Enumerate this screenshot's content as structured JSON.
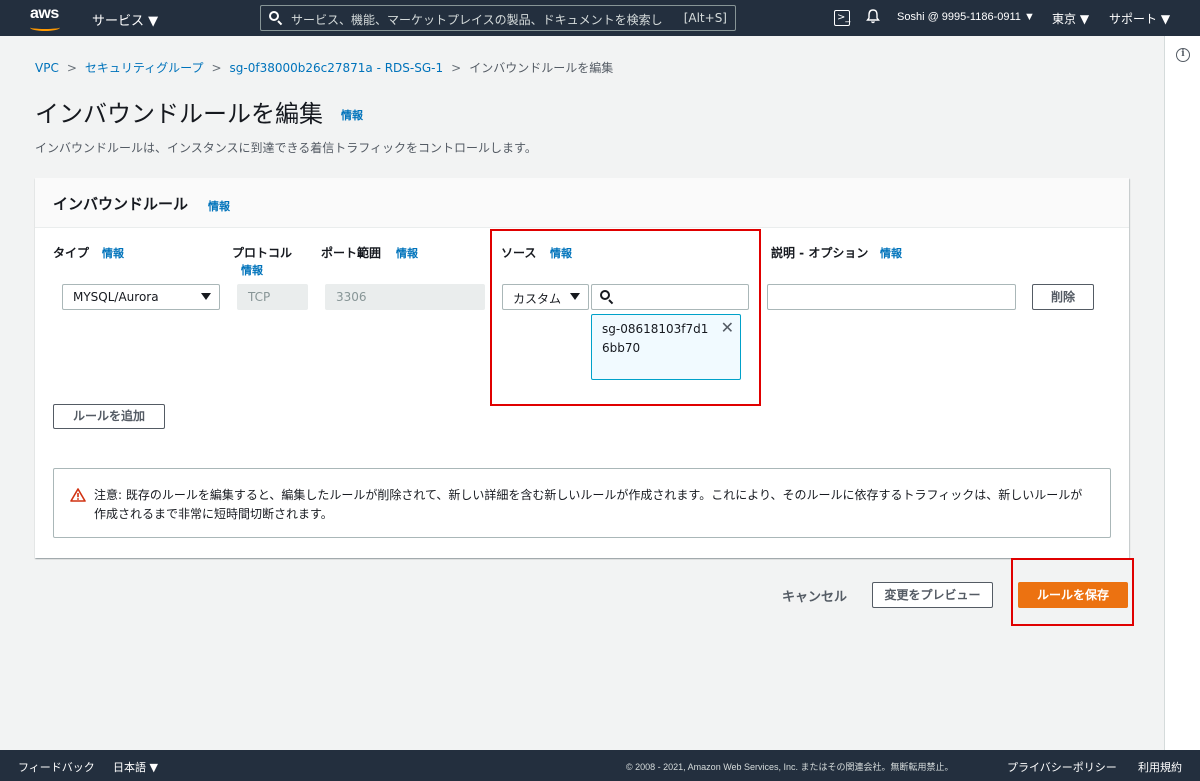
{
  "topnav": {
    "logo": "aws",
    "services": "サービス ▼",
    "search_placeholder": "サービス、機能、マーケットプレイスの製品、ドキュメントを検索し",
    "search_shortcut": "[Alt+S]",
    "cloudshell_icon": "cloudshell-icon",
    "bell_icon": "bell-icon",
    "account": "Soshi @ 9995-1186-0911 ▼",
    "region": "東京 ▼",
    "support": "サポート ▼"
  },
  "breadcrumb": {
    "items": [
      "VPC",
      "セキュリティグループ",
      "sg-0f38000b26c27871a - RDS-SG-1"
    ],
    "current": "インバウンドルールを編集"
  },
  "page": {
    "title": "インバウンドルールを編集",
    "title_info": "情報",
    "description": "インバウンドルールは、インスタンスに到達できる着信トラフィックをコントロールします。"
  },
  "card": {
    "title": "インバウンドルール",
    "title_info": "情報",
    "columns": {
      "type": "タイプ",
      "type_info": "情報",
      "protocol": "プロトコル",
      "protocol_info": "情報",
      "port": "ポート範囲",
      "port_info": "情報",
      "source": "ソース",
      "source_info": "情報",
      "description": "説明 - オプション",
      "description_info": "情報"
    },
    "rule": {
      "type": "MYSQL/Aurora",
      "protocol": "TCP",
      "port": "3306",
      "source_mode": "カスタム",
      "source_search_value": "",
      "source_token": "sg-08618103f7d16bb70",
      "description_value": "",
      "delete_label": "削除"
    },
    "add_rule_label": "ルールを追加",
    "alert": "注意: 既存のルールを編集すると、編集したルールが削除されて、新しい詳細を含む新しいルールが作成されます。これにより、そのルールに依存するトラフィックは、新しいルールが作成されるまで非常に短時間切断されます。"
  },
  "actions": {
    "cancel": "キャンセル",
    "preview": "変更をプレビュー",
    "save": "ルールを保存"
  },
  "footer": {
    "feedback": "フィードバック",
    "language": "日本語 ▼",
    "copyright": "© 2008 - 2021, Amazon Web Services, Inc. またはその関連会社。無断転用禁止。",
    "privacy": "プライバシーポリシー",
    "terms": "利用規約"
  },
  "colors": {
    "nav_bg": "#232f3e",
    "link": "#0073bb",
    "primary": "#ec7211",
    "highlight_box": "#e00000"
  }
}
